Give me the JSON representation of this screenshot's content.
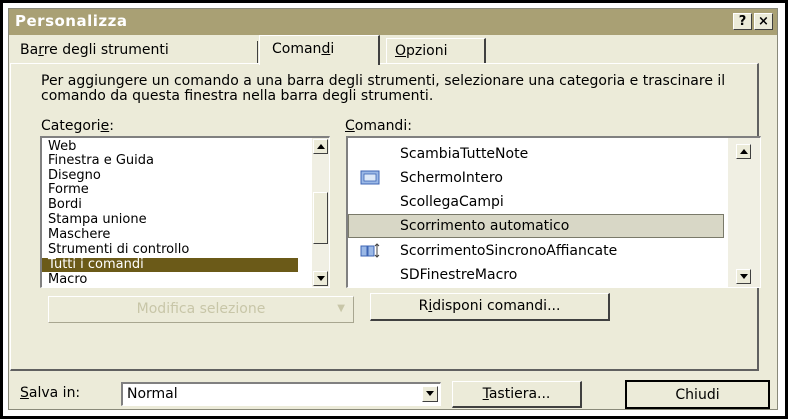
{
  "dialog": {
    "title": "Personalizza",
    "help_label": "?",
    "close_label": "×"
  },
  "tabs": [
    {
      "label": "Barre degli strumenti",
      "hotkey": "r"
    },
    {
      "label": "Comandi",
      "hotkey": "d"
    },
    {
      "label": "Opzioni",
      "hotkey": "O"
    }
  ],
  "instructions": "Per aggiungere un comando a una barra degli strumenti, selezionare una categoria e trascinare il comando da questa finestra nella barra degli strumenti.",
  "categories": {
    "label": "Categorie:",
    "items": [
      "Web",
      "Finestra e Guida",
      "Disegno",
      "Forme",
      "Bordi",
      "Stampa unione",
      "Maschere",
      "Strumenti di controllo",
      "Tutti i comandi",
      "Macro"
    ],
    "selected": "Tutti i comandi"
  },
  "commands": {
    "label": "Comandi:",
    "items": [
      {
        "label": "ScambiaTutteNote",
        "icon": ""
      },
      {
        "label": "SchermoIntero",
        "icon": "full-screen-icon"
      },
      {
        "label": "ScollegaCampi",
        "icon": ""
      },
      {
        "label": "Scorrimento automatico",
        "icon": ""
      },
      {
        "label": "ScorrimentoSincronoAffiancate",
        "icon": "synchronous-scrolling-icon"
      },
      {
        "label": "SDFinestreMacro",
        "icon": ""
      }
    ],
    "selected": "Scorrimento automatico"
  },
  "buttons": {
    "modify": "Modifica selezione",
    "modify_arrow": "▼",
    "rearrange": "Ridisponi comandi...",
    "keyboard": "Tastiera...",
    "close": "Chiudi"
  },
  "save_in": {
    "label": "Salva in:",
    "value": "Normal"
  },
  "colors": {
    "titlebar": "#a9a074",
    "selection": "#6b5a18",
    "dialog_bg": "#ecebd9"
  }
}
